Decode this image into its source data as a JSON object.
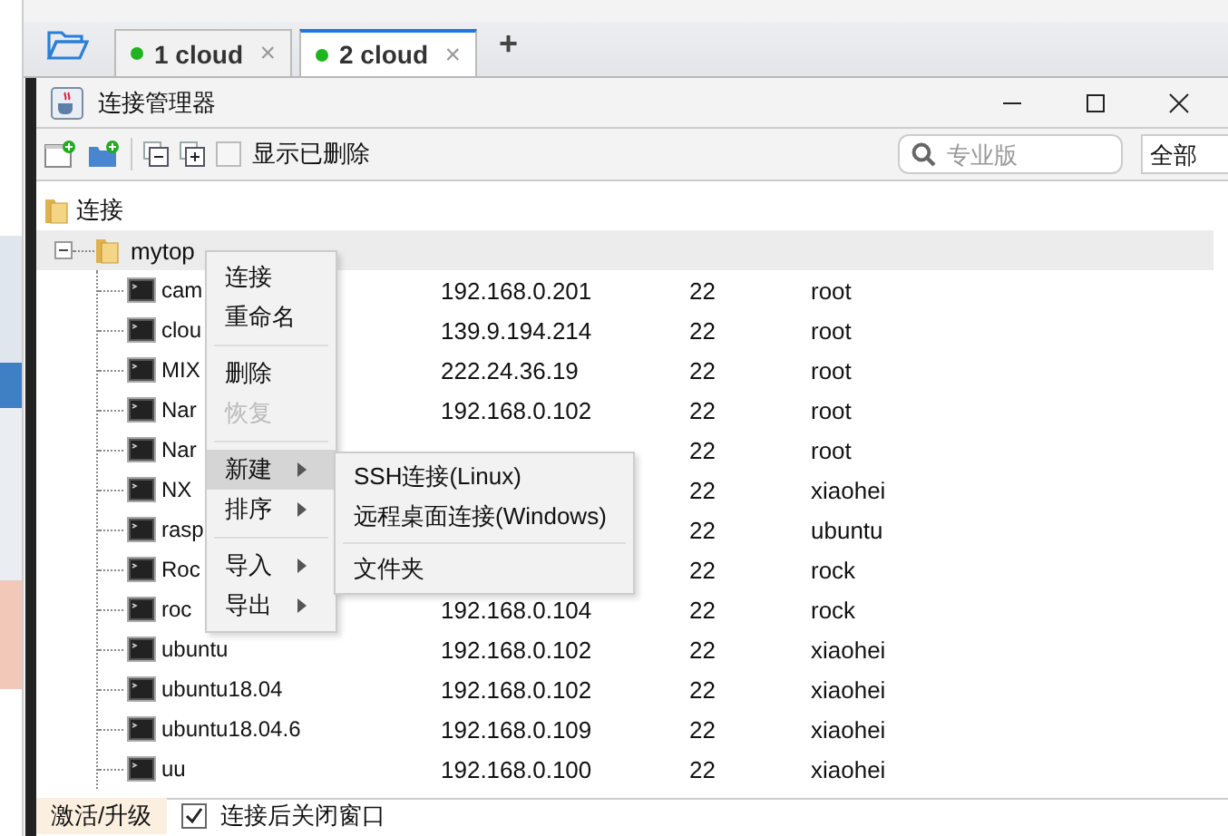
{
  "tabs": [
    {
      "label": "1 cloud",
      "selected": false,
      "connected": true,
      "close": "×"
    },
    {
      "label": "2 cloud",
      "selected": true,
      "connected": true,
      "close": "×"
    }
  ],
  "new_tab": "+",
  "window": {
    "title": "连接管理器"
  },
  "toolbar": {
    "show_deleted": {
      "label": "显示已删除",
      "checked": false
    },
    "search": {
      "placeholder": "专业版"
    },
    "filter": {
      "value": "全部"
    }
  },
  "tree": [
    {
      "label": "连接",
      "children": [
        {
          "label": "mytop",
          "selected": true,
          "expanded": true,
          "children": [
            {
              "name": "cam",
              "ip": "192.168.0.201",
              "port": "22",
              "user": "root"
            },
            {
              "name": "clou",
              "ip": "139.9.194.214",
              "port": "22",
              "user": "root"
            },
            {
              "name": "MIX",
              "ip": "222.24.36.19",
              "port": "22",
              "user": "root"
            },
            {
              "name": "Nar",
              "ip": "192.168.0.102",
              "port": "22",
              "user": "root"
            },
            {
              "name": "Nar",
              "port": "22",
              "user": "root"
            },
            {
              "name": "NX",
              "port": "22",
              "user": "xiaohei"
            },
            {
              "name": "rasp",
              "port": "22",
              "user": "ubuntu"
            },
            {
              "name": "Roc",
              "port": "22",
              "user": "rock"
            },
            {
              "name": "roc",
              "ip": "192.168.0.104",
              "port": "22",
              "user": "rock"
            },
            {
              "name": "ubuntu",
              "ip": "192.168.0.102",
              "port": "22",
              "user": "xiaohei"
            },
            {
              "name": "ubuntu18.04",
              "ip": "192.168.0.102",
              "port": "22",
              "user": "xiaohei"
            },
            {
              "name": "ubuntu18.04.6",
              "ip": "192.168.0.109",
              "port": "22",
              "user": "xiaohei"
            },
            {
              "name": "uu",
              "ip": "192.168.0.100",
              "port": "22",
              "user": "xiaohei"
            }
          ]
        }
      ]
    }
  ],
  "context_menu": [
    {
      "kind": "item",
      "label": "连接",
      "disabled": false,
      "selected": false,
      "submenu": false
    },
    {
      "kind": "item",
      "label": "重命名",
      "disabled": false,
      "selected": false,
      "submenu": false
    },
    {
      "kind": "separator"
    },
    {
      "kind": "item",
      "label": "删除",
      "disabled": false,
      "selected": false,
      "submenu": false
    },
    {
      "kind": "item",
      "label": "恢复",
      "disabled": true,
      "selected": false,
      "submenu": false
    },
    {
      "kind": "separator"
    },
    {
      "kind": "item",
      "label": "新建",
      "disabled": false,
      "selected": true,
      "submenu": true
    },
    {
      "kind": "item",
      "label": "排序",
      "disabled": false,
      "selected": false,
      "submenu": true
    },
    {
      "kind": "separator"
    },
    {
      "kind": "item",
      "label": "导入",
      "disabled": false,
      "selected": false,
      "submenu": true
    },
    {
      "kind": "item",
      "label": "导出",
      "disabled": false,
      "selected": false,
      "submenu": true
    }
  ],
  "submenu": [
    {
      "kind": "item",
      "label": "SSH连接(Linux)"
    },
    {
      "kind": "item",
      "label": "远程桌面连接(Windows)"
    },
    {
      "kind": "separator"
    },
    {
      "kind": "item",
      "label": "文件夹"
    }
  ],
  "footer": {
    "activate": "激活/升级",
    "close_after_connect": {
      "label": "连接后关闭窗口",
      "checked": true
    }
  }
}
